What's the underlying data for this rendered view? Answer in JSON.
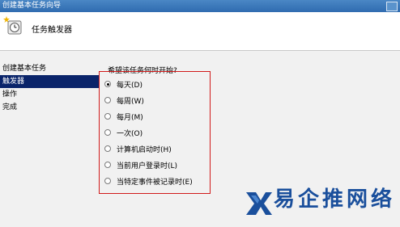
{
  "window": {
    "title": "创建基本任务向导"
  },
  "header": {
    "title": "任务触发器",
    "icon": "task-clock-icon"
  },
  "nav": {
    "items": [
      {
        "label": "创建基本任务"
      },
      {
        "label": "触发器"
      },
      {
        "label": "操作"
      },
      {
        "label": "完成"
      }
    ],
    "active": "触发器"
  },
  "main": {
    "question": "希望该任务何时开始?",
    "options": [
      {
        "label": "每天(D)",
        "checked": true
      },
      {
        "label": "每周(W)",
        "checked": false
      },
      {
        "label": "每月(M)",
        "checked": false
      },
      {
        "label": "一次(O)",
        "checked": false
      },
      {
        "label": "计算机启动时(H)",
        "checked": false
      },
      {
        "label": "当前用户登录时(L)",
        "checked": false
      },
      {
        "label": "当特定事件被记录时(E)",
        "checked": false
      }
    ]
  },
  "watermark": {
    "text": "易企推网络"
  },
  "colors": {
    "highlight_box": "#d11a1a",
    "nav_active": "#0a246a",
    "watermark": "#1a4f9c"
  }
}
